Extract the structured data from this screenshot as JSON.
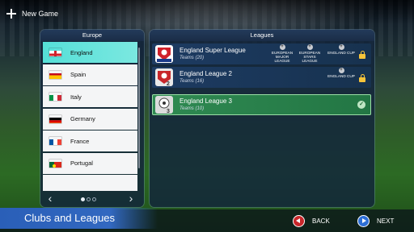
{
  "header": {
    "new_game_label": "New Game"
  },
  "europe_panel": {
    "title": "Europe",
    "countries": [
      {
        "name": "England",
        "selected": true
      },
      {
        "name": "Spain",
        "selected": false
      },
      {
        "name": "Italy",
        "selected": false
      },
      {
        "name": "Germany",
        "selected": false
      },
      {
        "name": "France",
        "selected": false
      },
      {
        "name": "Portugal",
        "selected": false
      }
    ],
    "carousel": {
      "prev_icon": "‹",
      "next_icon": "›",
      "pages": 3,
      "current_page": 1
    }
  },
  "leagues_panel": {
    "title": "Leagues",
    "leagues": [
      {
        "name": "England Super League",
        "teams": "Teams (20)",
        "cups": [
          "EUROPEAN MAJOR LEAGUE",
          "EUROPEAN STARS LEAGUE",
          "ENGLAND CUP"
        ],
        "status": "locked",
        "logo_text": "SUPER LEAGUE"
      },
      {
        "name": "England League 2",
        "teams": "Teams (16)",
        "cups": [
          "ENGLAND CUP"
        ],
        "status": "locked",
        "logo_text": "LEAGUE 2"
      },
      {
        "name": "England League 3",
        "teams": "Teams (10)",
        "cups": [],
        "status": "selected",
        "logo_text": "LEAGUE 3"
      }
    ]
  },
  "footer": {
    "page_title": "Clubs and Leagues",
    "back_label": "BACK",
    "next_label": "NEXT"
  },
  "colors": {
    "selected_country": "#55dfd8",
    "selected_league": "#2f8a52",
    "back_button": "#c8262a",
    "next_button": "#2d6fd6",
    "lock": "#f7c43a"
  }
}
